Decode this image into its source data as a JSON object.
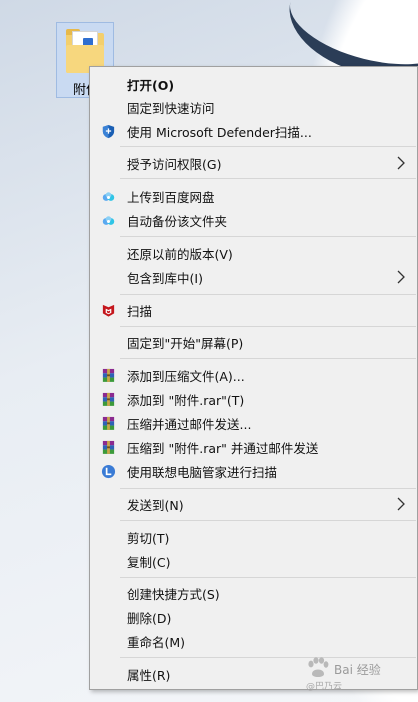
{
  "desktop": {
    "icon_label": "附件"
  },
  "menu": {
    "items": [
      {
        "label": "打开(O)",
        "icon": "none"
      },
      {
        "label": "固定到快速访问",
        "icon": "none"
      },
      {
        "label": "使用 Microsoft Defender扫描...",
        "icon": "defender-shield-icon"
      },
      {
        "label": "授予访问权限(G)",
        "icon": "none"
      },
      {
        "label": "上传到百度网盘",
        "icon": "baidu-netdisk-icon"
      },
      {
        "label": "自动备份该文件夹",
        "icon": "baidu-netdisk-icon"
      },
      {
        "label": "还原以前的版本(V)",
        "icon": "none"
      },
      {
        "label": "包含到库中(I)",
        "icon": "none"
      },
      {
        "label": "扫描",
        "icon": "mcafee-icon"
      },
      {
        "label": "固定到\"开始\"屏幕(P)",
        "icon": "none"
      },
      {
        "label": "添加到压缩文件(A)...",
        "icon": "winrar-icon"
      },
      {
        "label": "添加到 \"附件.rar\"(T)",
        "icon": "winrar-icon"
      },
      {
        "label": "压缩并通过邮件发送...",
        "icon": "winrar-icon"
      },
      {
        "label": "压缩到 \"附件.rar\" 并通过邮件发送",
        "icon": "winrar-icon"
      },
      {
        "label": "使用联想电脑管家进行扫描",
        "icon": "lenovo-pc-manager-icon"
      },
      {
        "label": "发送到(N)",
        "icon": "none"
      },
      {
        "label": "剪切(T)",
        "icon": "none"
      },
      {
        "label": "复制(C)",
        "icon": "none"
      },
      {
        "label": "创建快捷方式(S)",
        "icon": "none"
      },
      {
        "label": "删除(D)",
        "icon": "none"
      },
      {
        "label": "重命名(M)",
        "icon": "none"
      },
      {
        "label": "属性(R)",
        "icon": "none"
      }
    ]
  },
  "watermark": {
    "text": "Bai 经验",
    "subtext": "@巴乃云"
  },
  "colors": {
    "menu_background": "#f0f0f0",
    "separator": "#d6d6d6",
    "selection_highlight": "#c9daf2",
    "defender_blue": "#1a5fb4",
    "mcafee_red": "#c4161c",
    "lenovo_blue": "#3a7bd5"
  }
}
